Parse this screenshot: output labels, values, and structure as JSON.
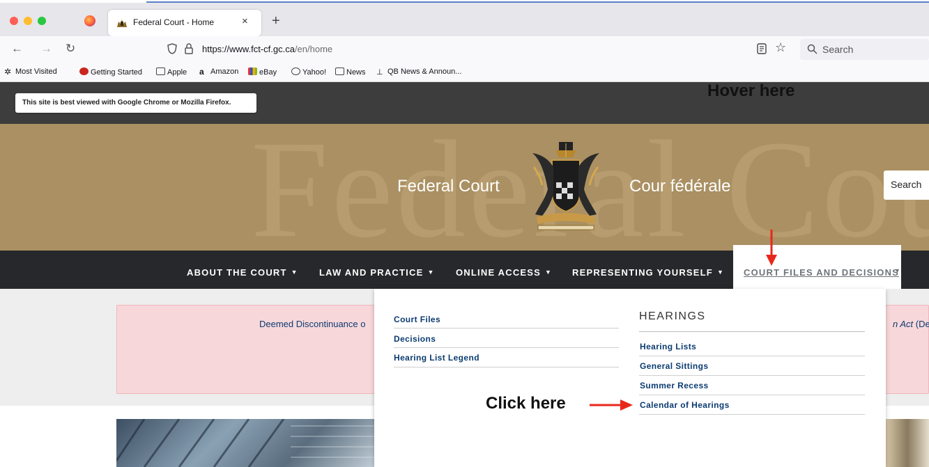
{
  "browser": {
    "tab_title": "Federal Court - Home",
    "tab_close": "×",
    "new_tab": "+",
    "url_host": "https://www.fct-cf.gc.ca",
    "url_path": "/en/home",
    "search_placeholder": "Search",
    "bookmarks": [
      "Most Visited",
      "Getting Started",
      "Apple",
      "Amazon",
      "eBay",
      "Yahoo!",
      "News",
      "QB News & Announ..."
    ]
  },
  "site": {
    "notice": "This site is best viewed with Google Chrome or Mozilla Firefox.",
    "court_en": "Federal Court",
    "court_fr": "Cour fédérale",
    "watermark": "Federal Court",
    "search_button": "Search",
    "nav": [
      "ABOUT THE COURT",
      "LAW AND PRACTICE",
      "ONLINE ACCESS",
      "REPRESENTING YOURSELF",
      "COURT FILES AND DECISIONS"
    ],
    "alert_left": "Deemed Discontinuance o",
    "alert_right_italic": "n Act",
    "alert_right": " (Dec"
  },
  "dropdown": {
    "left_links": [
      "Court Files",
      "Decisions",
      "Hearing List Legend"
    ],
    "hearings_heading": "HEARINGS",
    "hearings_links": [
      "Hearing Lists",
      "General Sittings",
      "Summer Recess",
      "Calendar of Hearings"
    ]
  },
  "annotations": {
    "hover": "Hover here",
    "click": "Click here",
    "color": "#e8271c"
  }
}
